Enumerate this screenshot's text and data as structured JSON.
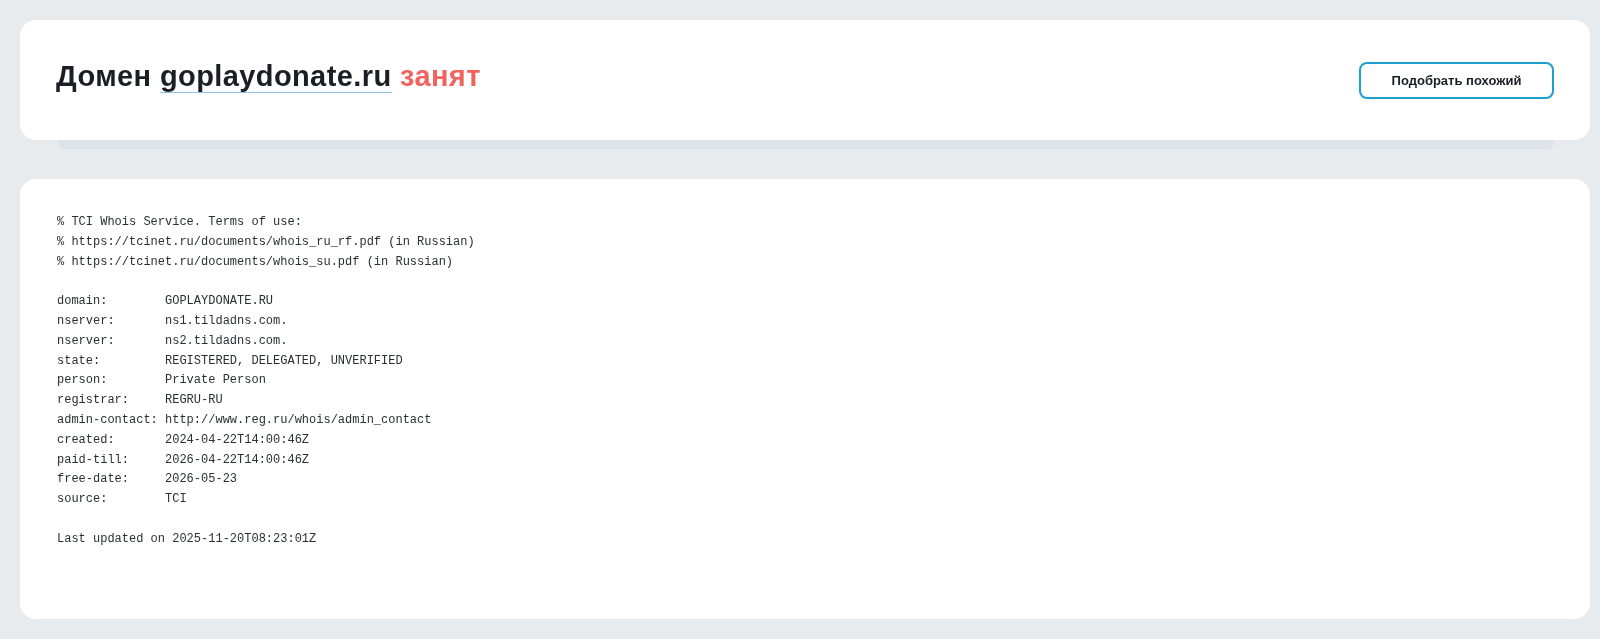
{
  "header": {
    "title": {
      "prefix": "Домен",
      "domain": "goplaydonate.ru",
      "status": "занят",
      "taken": true
    },
    "button": "Подобрать похожий"
  },
  "whois": {
    "notice": [
      "% TCI Whois Service. Terms of use:",
      "% https://tcinet.ru/documents/whois_ru_rf.pdf (in Russian)",
      "% https://tcinet.ru/documents/whois_su.pdf (in Russian)"
    ],
    "records": [
      {
        "label": "domain:",
        "value": "GOPLAYDONATE.RU"
      },
      {
        "label": "nserver:",
        "value": "ns1.tildadns.com."
      },
      {
        "label": "nserver:",
        "value": "ns2.tildadns.com."
      },
      {
        "label": "state:",
        "value": "REGISTERED, DELEGATED, UNVERIFIED"
      },
      {
        "label": "person:",
        "value": "Private Person"
      },
      {
        "label": "registrar:",
        "value": "REGRU-RU"
      },
      {
        "label": "admin-contact:",
        "value": "http://www.reg.ru/whois/admin_contact"
      },
      {
        "label": "created:",
        "value": "2024-04-22T14:00:46Z"
      },
      {
        "label": "paid-till:",
        "value": "2026-04-22T14:00:46Z"
      },
      {
        "label": "free-date:",
        "value": "2026-05-23"
      },
      {
        "label": "source:",
        "value": "TCI"
      }
    ],
    "footer": "Last updated on 2025-11-20T08:23:01Z"
  }
}
